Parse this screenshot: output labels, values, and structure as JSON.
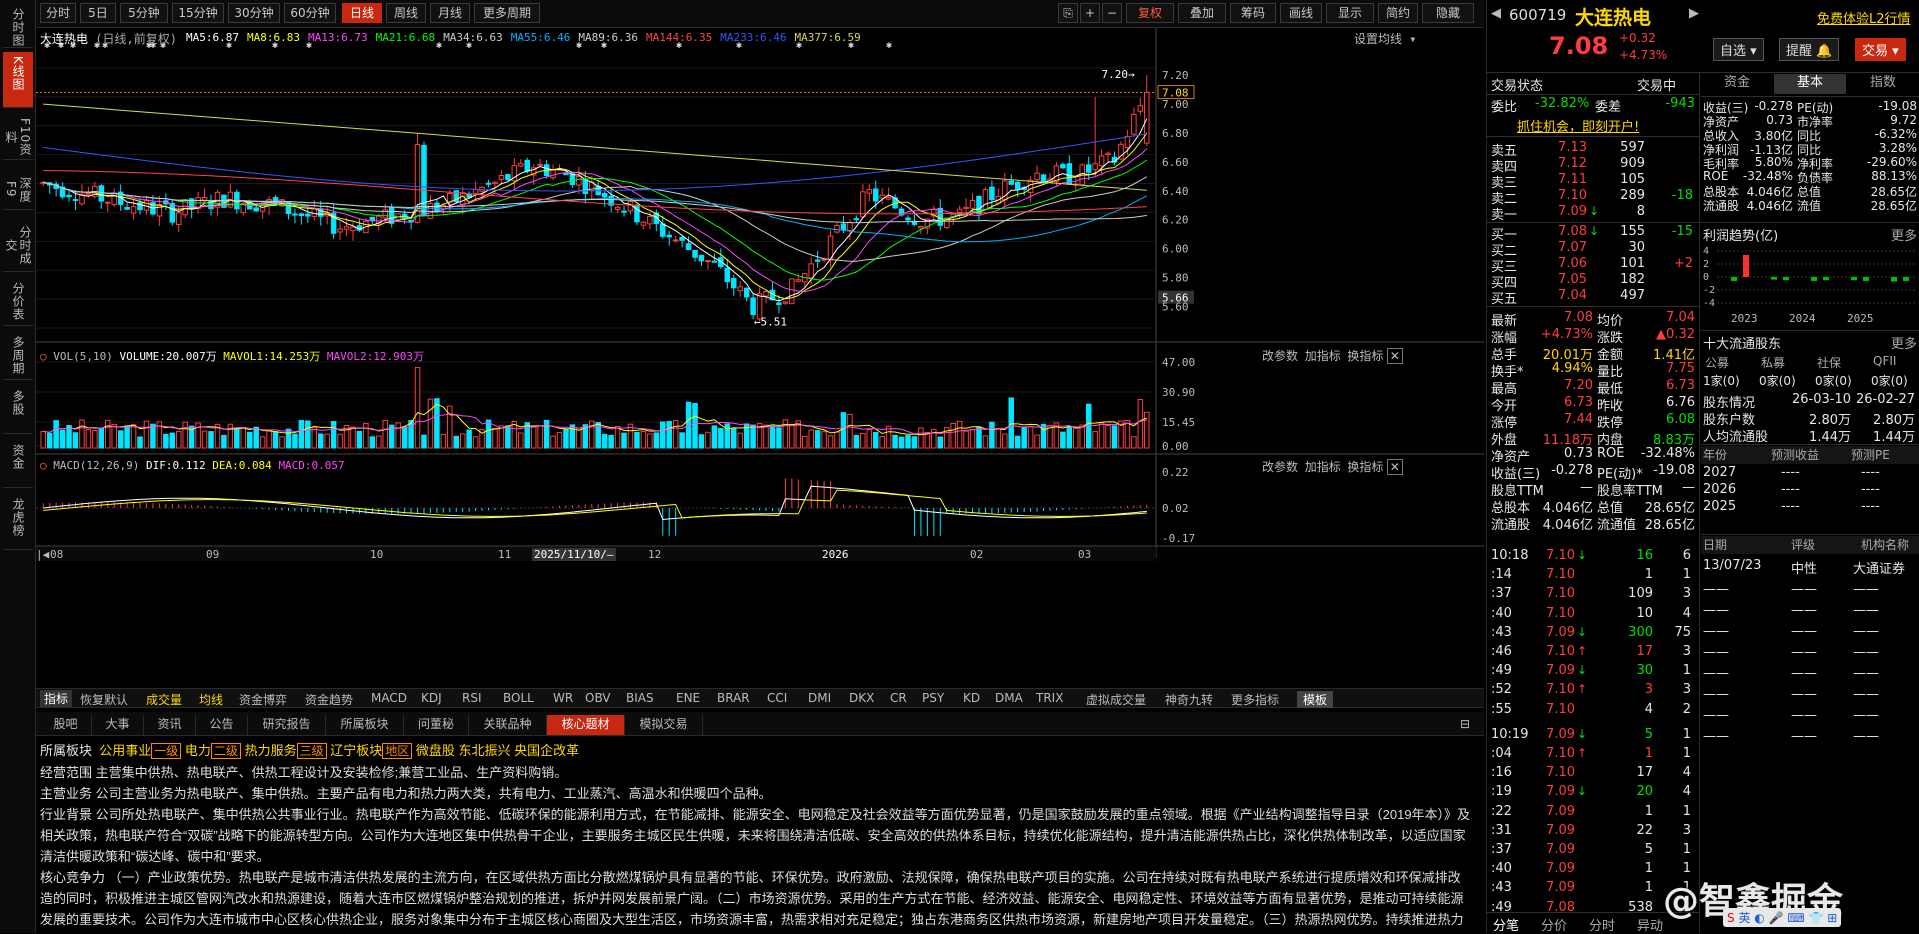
{
  "left_nav": [
    "分时图",
    "K线图",
    "F10资料",
    "深度F9",
    "分时成交",
    "分价表",
    "多周期",
    "多股",
    "资金",
    "龙虎榜"
  ],
  "period_tabs": [
    "分时",
    "5日",
    "5分钟",
    "15分钟",
    "30分钟",
    "60分钟",
    "日线",
    "周线",
    "月线",
    "更多周期"
  ],
  "toolbar": {
    "fuquan": "复权",
    "add": "叠加",
    "chip": "筹码",
    "draw": "画线",
    "display": "显示",
    "brief": "简约",
    "hide": "隐藏"
  },
  "chart": {
    "title": "大连热电",
    "mode": "(日线,前复权)",
    "ma": [
      {
        "label": "MA5:6.87",
        "color": "#ffffff"
      },
      {
        "label": "MA8:6.83",
        "color": "#ffff00"
      },
      {
        "label": "MA13:6.73",
        "color": "#ff44ff"
      },
      {
        "label": "MA21:6.68",
        "color": "#00ff00"
      },
      {
        "label": "MA34:6.63",
        "color": "#cccccc"
      },
      {
        "label": "MA55:6.46",
        "color": "#00b0ff"
      },
      {
        "label": "MA89:6.36",
        "color": "#cccccc"
      },
      {
        "label": "MA144:6.35",
        "color": "#ff4444"
      },
      {
        "label": "MA233:6.46",
        "color": "#3355ff"
      },
      {
        "label": "MA377:6.59",
        "color": "#d8d84a"
      }
    ],
    "setting": "设置均线",
    "price_ticks": [
      "7.20",
      "7.00",
      "6.80",
      "6.60",
      "6.40",
      "6.20",
      "6.00",
      "5.80",
      "5.66",
      "5.60"
    ],
    "current_price_tag": "7.08",
    "high_mark": "7.20",
    "low_mark": "5.51",
    "x_ticks": [
      "08",
      "09",
      "10",
      "11",
      "2025/11/10/—",
      "12",
      "2026",
      "02",
      "03"
    ]
  },
  "chart_data": {
    "type": "candlestick",
    "ylim": [
      5.45,
      7.25
    ],
    "high": 7.2,
    "low": 5.51,
    "last": 7.08
  },
  "vol": {
    "label": "VOL(5,10)",
    "items": [
      {
        "t": "VOLUME:20.007万",
        "c": "#ffffff"
      },
      {
        "t": "MAVOL1:14.253万",
        "c": "#ffff00"
      },
      {
        "t": "MAVOL2:12.903万",
        "c": "#ff44ff"
      }
    ],
    "ticks": [
      "47.00",
      "30.90",
      "15.45",
      "0.00"
    ],
    "actions": [
      "改参数",
      "加指标",
      "换指标"
    ]
  },
  "macd": {
    "label": "MACD(12,26,9)",
    "items": [
      {
        "t": "DIF:0.112",
        "c": "#ffffff"
      },
      {
        "t": "DEA:0.084",
        "c": "#ffff00"
      },
      {
        "t": "MACD:0.057",
        "c": "#ff44ff"
      }
    ],
    "ticks": [
      "0.22",
      "0.02",
      "-0.17"
    ]
  },
  "indicator_bar": [
    "指标",
    "恢复默认",
    "成交量",
    "均线",
    "资金博弈",
    "资金趋势",
    "MACD",
    "KDJ",
    "RSI",
    "BOLL",
    "WR",
    "OBV",
    "BIAS",
    "ENE",
    "BRAR",
    "CCI",
    "DMI",
    "DKX",
    "CR",
    "PSY",
    "KD",
    "DMA",
    "TRIX",
    "虚拟成交量",
    "神奇九转",
    "更多指标",
    "模板"
  ],
  "bottom_tabs": [
    "股吧",
    "大事",
    "资讯",
    "公告",
    "研究报告",
    "所属板块",
    "问董秘",
    "关联品种",
    "核心题材",
    "模拟交易"
  ],
  "f10": {
    "sector_label": "所属板块",
    "sectors": [
      {
        "t": "公用事业",
        "tag": "一级"
      },
      {
        "t": "电力",
        "tag": "二级"
      },
      {
        "t": "热力服务",
        "tag": "三级"
      },
      {
        "t": "辽宁板块",
        "tag": "地区"
      },
      {
        "t": "微盘股"
      },
      {
        "t": "东北振兴"
      },
      {
        "t": "央国企改革"
      }
    ],
    "rows": [
      {
        "k": "经营范围",
        "v": "主营集中供热、热电联产、供热工程设计及安装检修;兼营工业品、生产资料购销。"
      },
      {
        "k": "主营业务",
        "v": "公司主营业务为热电联产、集中供热。主要产品有电力和热力两大类，共有电力、工业蒸汽、高温水和供暖四个品种。"
      },
      {
        "k": "行业背景",
        "v": "公司所处热电联产、集中供热公共事业行业。热电联产作为高效节能、低碳环保的能源利用方式，在节能减排、能源安全、电网稳定及社会效益等方面优势显著，仍是国家鼓励发展的重点领域。根据《产业结构调整指导目录（2019年本）》及相关政策，热电联产符合“双碳”战略下的能源转型方向。公司作为大连地区集中供热骨干企业，主要服务主城区民生供暖，未来将围绕清洁低碳、安全高效的供热体系目标，持续优化能源结构，提升清洁能源供热占比，深化供热体制改革，以适应国家清洁供暖政策和“碳达峰、碳中和”要求。"
      },
      {
        "k": "核心竞争力",
        "v": "（一）产业政策优势。热电联产是城市清洁供热发展的主流方向，在区域供热方面比分散燃煤锅炉具有显著的节能、环保优势。政府激励、法规保障，确保热电联产项目的实施。公司在持续对既有热电联产系统进行提质增效和环保减排改造的同时，积极推进主城区管网汽改水和热源建设，随着大连市区燃煤锅炉整治规划的推进，拆炉并网发展前景广阔。（二）市场资源优势。采用的生产方式在节能、经济效益、能源安全、电网稳定性、环境效益等方面有显著优势，是推动可持续能源发展的重要技术。公司作为大连市城市中心区核心供热企业，服务对象集中分布于主城区核心商圈及大型生活区，市场资源丰富，热需求相对充足稳定；独占东港商务区供热市场资源，新建房地产项目开发量稳定。（三）热源热网优势。持续推进热力系统建设，"
      }
    ]
  },
  "quote": {
    "code": "600719",
    "name": "大连热电",
    "trial": "免费体验L2行情",
    "price": "7.08",
    "chg": "+0.32",
    "pct": "+4.73%",
    "btn_watch": "自选",
    "btn_alert": "提醒",
    "btn_trade": "交易"
  },
  "tabs_right": [
    "资金",
    "基本",
    "指数"
  ],
  "trade_state": {
    "label": "交易状态",
    "value": "交易中"
  },
  "weibi": {
    "k1": "委比",
    "v1": "-32.82%",
    "k2": "委差",
    "v2": "-943"
  },
  "promo": "抓住机会，即刻开户!",
  "asks": [
    {
      "l": "卖五",
      "p": "7.13",
      "v": "597"
    },
    {
      "l": "卖四",
      "p": "7.12",
      "v": "909"
    },
    {
      "l": "卖三",
      "p": "7.11",
      "v": "105"
    },
    {
      "l": "卖二",
      "p": "7.10",
      "v": "289",
      "d": "-18"
    },
    {
      "l": "卖一",
      "p": "7.09",
      "v": "8"
    }
  ],
  "bids": [
    {
      "l": "买一",
      "p": "7.08",
      "v": "155",
      "d": "-15"
    },
    {
      "l": "买二",
      "p": "7.07",
      "v": "30"
    },
    {
      "l": "买三",
      "p": "7.06",
      "v": "101",
      "d": "+2"
    },
    {
      "l": "买四",
      "p": "7.05",
      "v": "182"
    },
    {
      "l": "买五",
      "p": "7.04",
      "v": "497"
    }
  ],
  "stats": [
    [
      "最新",
      "7.08",
      "均价",
      "7.04"
    ],
    [
      "涨幅",
      "+4.73%",
      "涨跌",
      "▲0.32"
    ],
    [
      "总手",
      "20.01万",
      "金额",
      "1.41亿"
    ],
    [
      "换手*",
      "4.94%",
      "量比",
      "7.75"
    ],
    [
      "最高",
      "7.20",
      "最低",
      "6.73"
    ],
    [
      "今开",
      "6.73",
      "昨收",
      "6.76"
    ],
    [
      "涨停",
      "7.44",
      "跌停",
      "6.08"
    ],
    [
      "外盘",
      "11.18万",
      "内盘",
      "8.83万"
    ],
    [
      "净资产",
      "0.73",
      "ROE",
      "-32.48%"
    ],
    [
      "收益(三)",
      "-0.278",
      "PE(动)*",
      "-19.08"
    ],
    [
      "股息TTM",
      "—",
      "股息率TTM",
      "—"
    ],
    [
      "总股本",
      "4.046亿",
      "总值",
      "28.65亿"
    ],
    [
      "流通股",
      "4.046亿",
      "流通值",
      "28.65亿"
    ]
  ],
  "ticks": [
    [
      "10:18",
      "7.10",
      "↓",
      "16",
      "6"
    ],
    [
      ":14",
      "7.10",
      "",
      "1",
      "1"
    ],
    [
      ":37",
      "7.10",
      "",
      "109",
      "3"
    ],
    [
      ":40",
      "7.10",
      "",
      "10",
      "4"
    ],
    [
      ":43",
      "7.09",
      "↓",
      "300",
      "75"
    ],
    [
      ":46",
      "7.10",
      "↑",
      "17",
      "3"
    ],
    [
      ":49",
      "7.09",
      "↓",
      "30",
      "1"
    ],
    [
      ":52",
      "7.10",
      "↑",
      "3",
      "3"
    ],
    [
      ":55",
      "7.10",
      "",
      "4",
      "2"
    ],
    [
      "10:19",
      "7.09",
      "↓",
      "5",
      "1"
    ],
    [
      ":04",
      "7.10",
      "↑",
      "1",
      "1"
    ],
    [
      ":16",
      "7.10",
      "",
      "17",
      "4"
    ],
    [
      ":19",
      "7.09",
      "↓",
      "20",
      "4"
    ],
    [
      ":22",
      "7.09",
      "",
      "1",
      "1"
    ],
    [
      ":31",
      "7.09",
      "",
      "22",
      "3"
    ],
    [
      ":37",
      "7.09",
      "",
      "5",
      "1"
    ],
    [
      ":40",
      "7.09",
      "",
      "1",
      "1"
    ],
    [
      ":43",
      "7.09",
      "",
      "1",
      "1"
    ],
    [
      ":49",
      "7.08",
      "",
      "538",
      "1"
    ]
  ],
  "tick_tabs": [
    "分笔",
    "分价",
    "分时",
    "异动"
  ],
  "fund": {
    "rows": [
      [
        "收益(三)",
        "-0.278",
        "PE(动)",
        "-19.08"
      ],
      [
        "净资产",
        "0.73",
        "市净率",
        "9.72"
      ],
      [
        "总收入",
        "3.80亿",
        "同比",
        "-6.32%"
      ],
      [
        "净利润",
        "-1.13亿",
        "同比",
        "3.28%"
      ],
      [
        "毛利率",
        "5.80%",
        "净利率",
        "-29.60%"
      ],
      [
        "ROE",
        "-32.48%",
        "负债率",
        "88.13%"
      ],
      [
        "总股本",
        "4.046亿",
        "总值",
        "28.65亿"
      ],
      [
        "流通股",
        "4.046亿",
        "流值",
        "28.65亿"
      ]
    ]
  },
  "profit_trend": {
    "title": "利润趋势(亿)",
    "more": "更多",
    "yticks": [
      "4",
      "2",
      "0",
      "-2",
      "-4"
    ],
    "years": [
      "2023",
      "2024",
      "2025"
    ]
  },
  "holders": {
    "title": "十大流通股东",
    "more": "更多",
    "cols": [
      "公募",
      "私募",
      "社保",
      "QFII"
    ],
    "vals": [
      "1家(0)",
      "0家(0)",
      "0家(0)",
      "0家(0)"
    ],
    "rows": [
      [
        "股东情况",
        "26-03-10",
        "26-02-27"
      ],
      [
        "股东户数",
        "2.80万",
        "2.80万"
      ],
      [
        "人均流通股",
        "1.44万",
        "1.44万"
      ]
    ]
  },
  "forecast": {
    "cols": [
      "年份",
      "预测收益",
      "预测PE"
    ],
    "rows": [
      [
        "2027",
        "----",
        "----"
      ],
      [
        "2026",
        "----",
        "----"
      ],
      [
        "2025",
        "----",
        "----"
      ]
    ]
  },
  "rating": {
    "cols": [
      "日期",
      "评级",
      "机构名称"
    ],
    "rows": [
      [
        "13/07/23",
        "中性",
        "大通证券"
      ]
    ]
  },
  "watermark": "@智鑫掘金",
  "tray": "英"
}
